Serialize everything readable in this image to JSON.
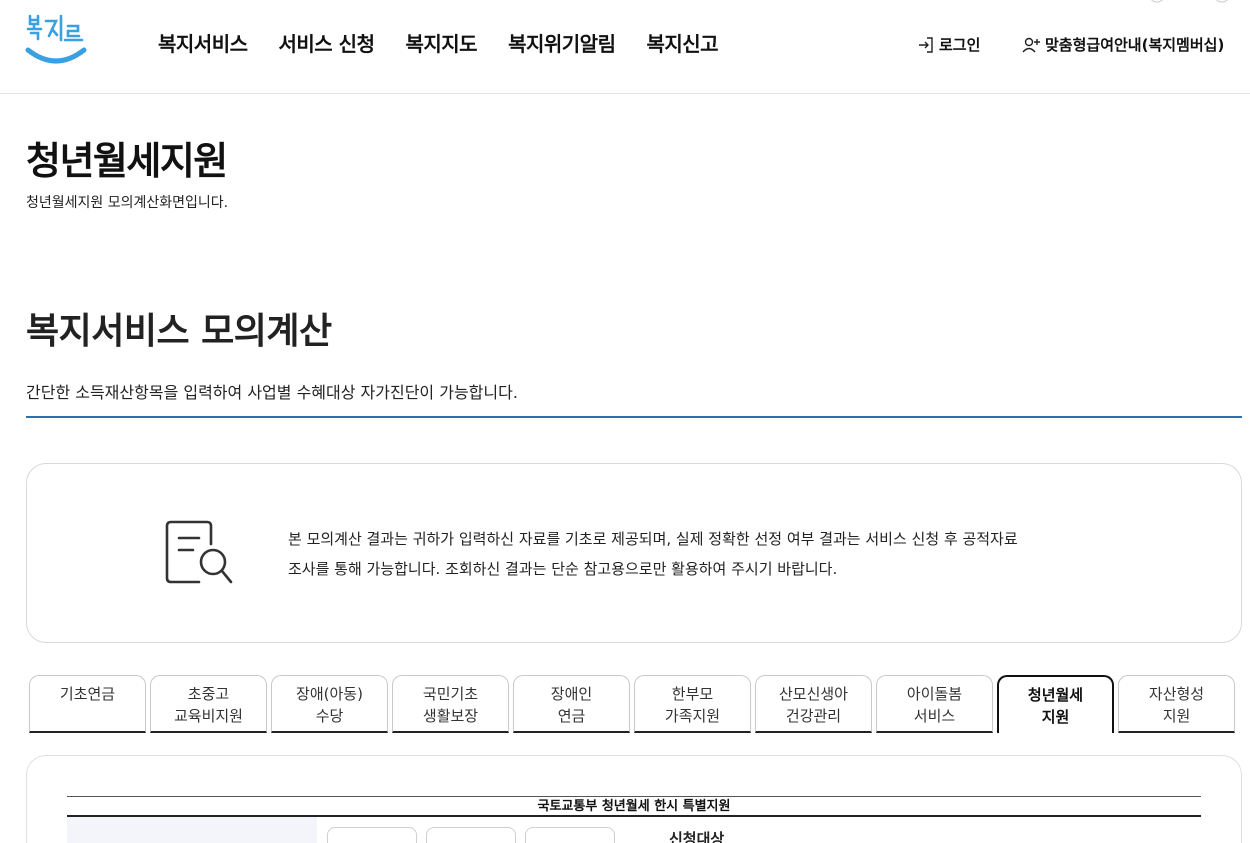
{
  "header": {
    "logo_text": "복지로",
    "nav": [
      "복지서비스",
      "서비스 신청",
      "복지지도",
      "복지위기알림",
      "복지신고"
    ],
    "login_label": "로그인",
    "member_label": "맞춤형급여안내(복지멤버십)"
  },
  "page": {
    "title": "청년월세지원",
    "description": "청년월세지원 모의계산화면입니다."
  },
  "section": {
    "title": "복지서비스 모의계산",
    "description": "간단한 소득재산항목을 입력하여 사업별 수혜대상 자가진단이 가능합니다."
  },
  "notice": {
    "line1": "본 모의계산 결과는 귀하가 입력하신 자료를 기초로 제공되며, 실제 정확한 선정 여부 결과는 서비스 신청 후 공적자료",
    "line2": "조사를 통해 가능합니다. 조회하신 결과는 단순 참고용으로만 활용하여 주시기 바랍니다."
  },
  "tabs": [
    {
      "label": "기초연금",
      "active": false
    },
    {
      "label": "초중고\n교육비지원",
      "active": false
    },
    {
      "label": "장애(아동)\n수당",
      "active": false
    },
    {
      "label": "국민기초\n생활보장",
      "active": false
    },
    {
      "label": "장애인\n연금",
      "active": false
    },
    {
      "label": "한부모\n가족지원",
      "active": false
    },
    {
      "label": "산모신생아\n건강관리",
      "active": false
    },
    {
      "label": "아이돌봄\n서비스",
      "active": false
    },
    {
      "label": "청년월세\n지원",
      "active": true
    },
    {
      "label": "자산형성\n지원",
      "active": false
    }
  ],
  "content": {
    "table_title": "국토교통부 청년월세 한시 특별지원",
    "row_label": "신청대상"
  },
  "colors": {
    "accent_line": "#2a6fb5",
    "logo_blue": "#3aa0e0"
  }
}
